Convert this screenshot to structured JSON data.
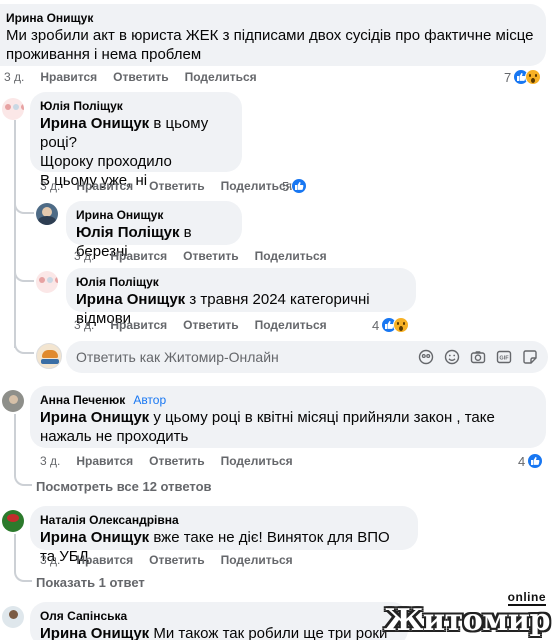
{
  "comments": [
    {
      "author": "Ирина Онищук",
      "mention": "",
      "text": "Ми зробили акт в юриста ЖЕК з підписами двох сусідів про фактичне місце проживання і нема проблем",
      "time": "3 д.",
      "reactions": "7"
    },
    {
      "author": "Юлія Поліщук",
      "mention": "Ирина Онищук",
      "text": " в цьому році?\nЩороку проходило\nВ цьому уже, ні",
      "time": "3 д.",
      "reactions": "5"
    },
    {
      "author": "Ирина Онищук",
      "mention": "Юлія Поліщук",
      "text": " в березні",
      "time": "3 д.",
      "reactions": ""
    },
    {
      "author": "Юлія Поліщук",
      "mention": "Ирина Онищук",
      "text": " з травня 2024 категоричні відмови",
      "time": "3 д.",
      "reactions": "4"
    },
    {
      "author": "Анна Печенюк",
      "badge": "Автор",
      "mention": "Ирина Онищук",
      "text": " у цьому році в квітні місяці прийняли закон , таке нажаль не проходить",
      "time": "3 д.",
      "reactions": "4"
    },
    {
      "author": "Наталія Олександрівна",
      "mention": "Ирина Онищук",
      "text": " вже таке не діє! Виняток для ВПО та УБД",
      "time": "3 д.",
      "reactions": ""
    },
    {
      "author": "Оля Сапінська",
      "mention": "Ирина Онищук",
      "text": " Ми також так робили ще три роки тому",
      "time": "",
      "reactions": ""
    }
  ],
  "actions": {
    "like": "Нравится",
    "reply": "Ответить",
    "share": "Поделиться"
  },
  "reply_box": {
    "placeholder": "Ответить как Житомир-Онлайн"
  },
  "links": {
    "view_all": "Посмотреть все 12 ответов",
    "show_one": "Показать 1 ответ"
  },
  "watermark": {
    "online": "online",
    "name": "Житомир"
  },
  "colors": {
    "bubble": "#f0f2f5",
    "like": "#1877f2",
    "author_badge": "#1877f2",
    "muted": "#65676b"
  },
  "icons": [
    "like-icon",
    "wow-icon",
    "emoji-icon",
    "camera-icon",
    "gif-icon",
    "sticker-icon",
    "avatar-icon"
  ]
}
